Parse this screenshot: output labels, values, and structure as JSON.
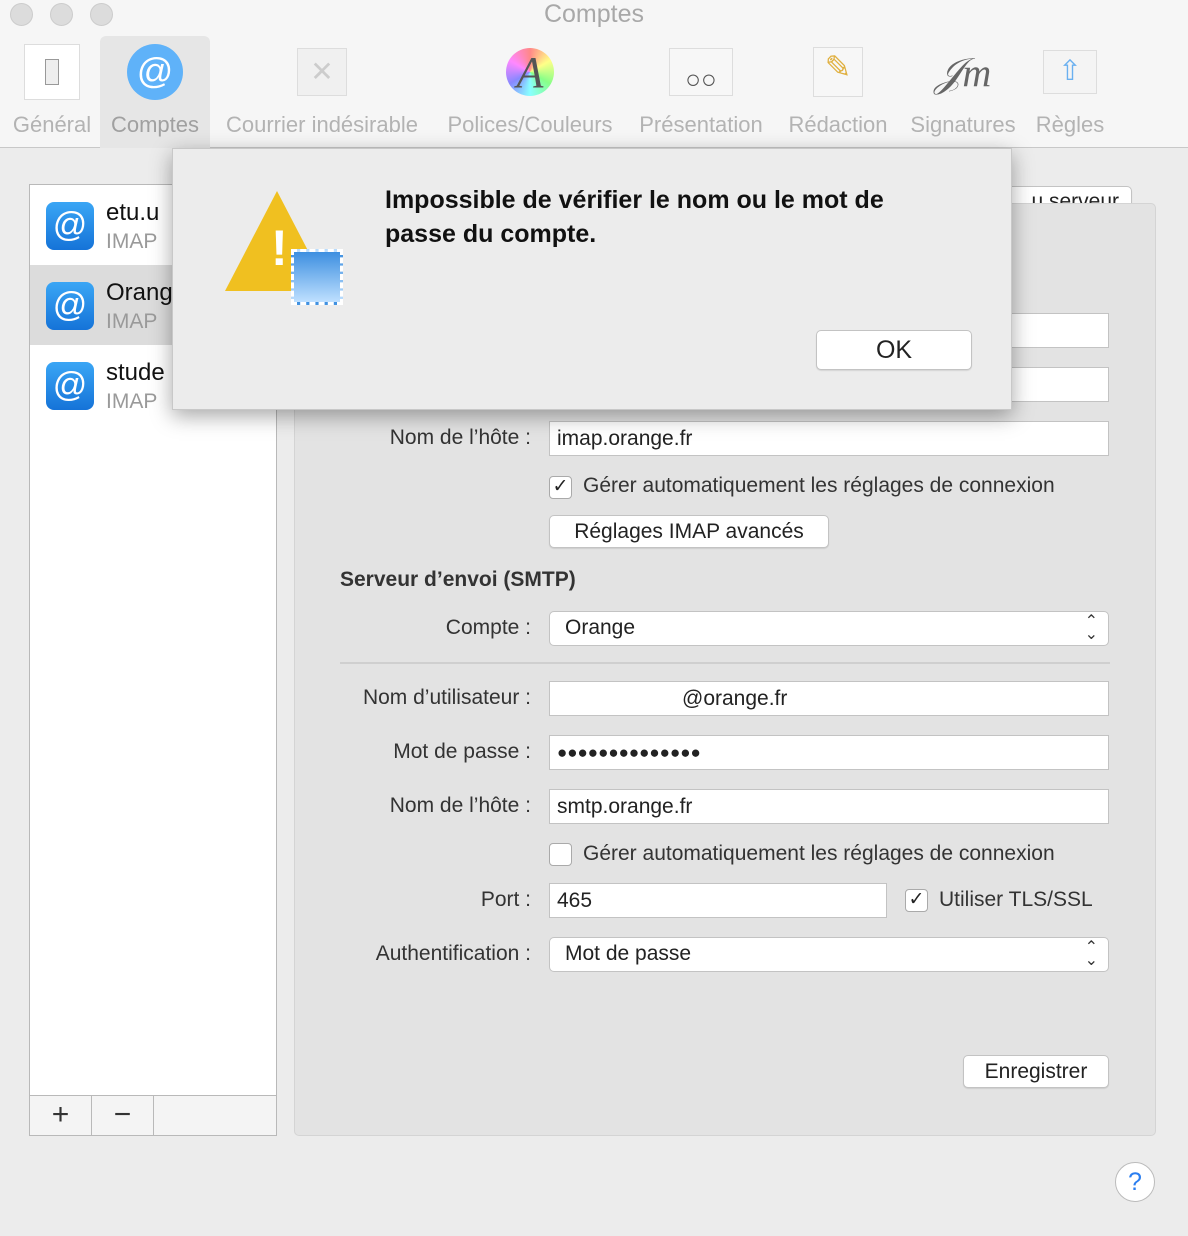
{
  "window": {
    "title": "Comptes"
  },
  "toolbar": [
    {
      "label": "Général",
      "icon": "switch-icon"
    },
    {
      "label": "Comptes",
      "icon": "at-icon",
      "selected": true
    },
    {
      "label": "Courrier indésirable",
      "icon": "junk-bin-icon"
    },
    {
      "label": "Polices/Couleurs",
      "icon": "fonts-colors-icon"
    },
    {
      "label": "Présentation",
      "icon": "glasses-icon"
    },
    {
      "label": "Rédaction",
      "icon": "pencil-icon"
    },
    {
      "label": "Signatures",
      "icon": "signature-icon"
    },
    {
      "label": "Règles",
      "icon": "rules-icon"
    }
  ],
  "accounts": [
    {
      "name": "etu.u",
      "protocol": "IMAP"
    },
    {
      "name": "Orang",
      "protocol": "IMAP",
      "selected": true
    },
    {
      "name": "stude",
      "protocol": "IMAP"
    }
  ],
  "sidebar_buttons": {
    "add": "+",
    "remove": "−"
  },
  "tab_partial": "u serveur",
  "incoming": {
    "host_label": "Nom de l’hôte :",
    "host": "imap.orange.fr",
    "auto_label": "Gérer automatiquement les réglages de connexion",
    "auto_checked": true,
    "advanced_button": "Réglages IMAP avancés"
  },
  "smtp": {
    "section_title": "Serveur d’envoi (SMTP)",
    "account_label": "Compte :",
    "account": "Orange",
    "user_label": "Nom d’utilisateur :",
    "user": "@orange.fr",
    "password_label": "Mot de passe :",
    "password": "●●●●●●●●●●●●●●",
    "host_label": "Nom de l’hôte :",
    "host": "smtp.orange.fr",
    "auto_label": "Gérer automatiquement les réglages de connexion",
    "auto_checked": false,
    "port_label": "Port :",
    "port": "465",
    "tls_label": "Utiliser TLS/SSL",
    "tls_checked": true,
    "auth_label": "Authentification :",
    "auth": "Mot de passe"
  },
  "save_button": "Enregistrer",
  "help": "?",
  "dialog": {
    "message": "Impossible de vérifier le nom ou le mot de passe du compte.",
    "ok": "OK"
  },
  "check_mark": "✓"
}
